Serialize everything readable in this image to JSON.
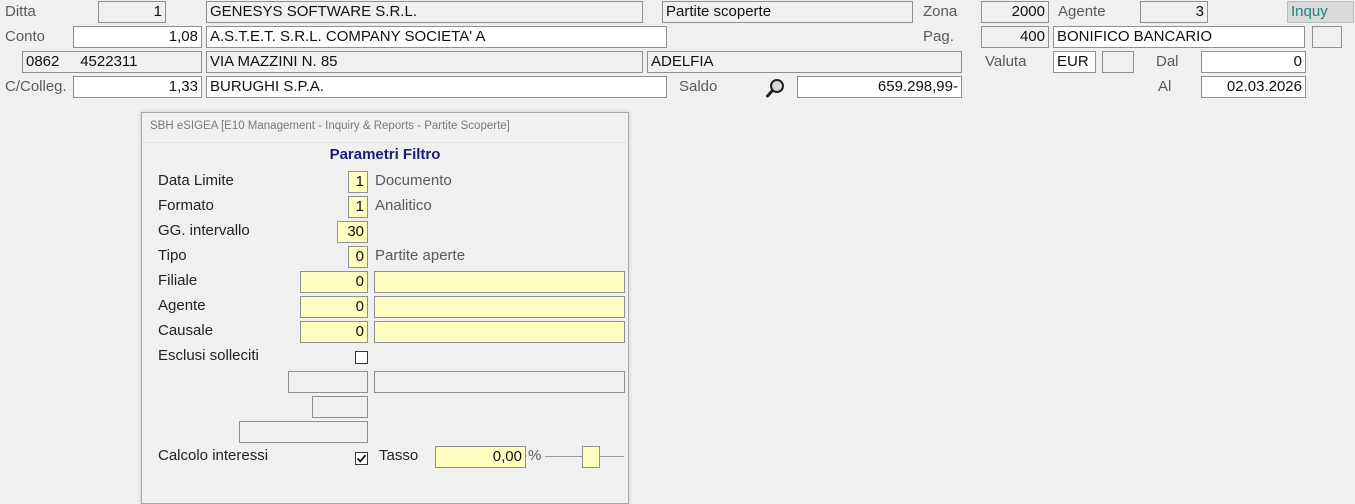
{
  "header": {
    "ditta_label": "Ditta",
    "ditta_code": "1",
    "ditta_name": "GENESYS SOFTWARE S.R.L.",
    "context_title": "Partite scoperte",
    "zona_label": "Zona",
    "zona_value": "2000",
    "agente_label": "Agente",
    "agente_value": "3",
    "mode": "Inquy",
    "conto_label": "Conto",
    "conto_value": "1,08",
    "conto_name": "A.S.T.E.T. S.R.L. COMPANY SOCIETA' A",
    "pag_label": "Pag.",
    "pag_code": "400",
    "pag_desc": "BONIFICO BANCARIO",
    "phone": "0862     4522311",
    "address": "VIA MAZZINI N. 85",
    "city": "ADELFIA",
    "valuta_label": "Valuta",
    "valuta_value": "EUR",
    "dal_label": "Dal",
    "dal_value": "0",
    "colleg_label": "C/Colleg.",
    "colleg_value": "1,33",
    "colleg_name": "BURUGHI S.P.A.",
    "saldo_label": "Saldo",
    "saldo_value": "659.298,99-",
    "al_label": "Al",
    "al_value": "02.03.2026",
    "icons": {
      "saldo_lookup": "magnifier-icon"
    }
  },
  "dialog": {
    "title": "SBH eSIGEA [E10 Management - Inquiry & Reports - Partite Scoperte]",
    "heading": "Parametri Filtro",
    "data_limite": {
      "label": "Data Limite",
      "value": "1",
      "desc": "Documento"
    },
    "formato": {
      "label": "Formato",
      "value": "1",
      "desc": "Analitico"
    },
    "gg_intervallo": {
      "label": "GG. intervallo",
      "value": "30"
    },
    "tipo": {
      "label": "Tipo",
      "value": "0",
      "desc": "Partite aperte"
    },
    "filiale": {
      "label": "Filiale",
      "value": "0",
      "desc": ""
    },
    "agente": {
      "label": "Agente",
      "value": "0",
      "desc": ""
    },
    "causale": {
      "label": "Causale",
      "value": "0",
      "desc": ""
    },
    "esclusi_solleciti": {
      "label": "Esclusi solleciti",
      "checked": false
    },
    "calcolo_interessi": {
      "label": "Calcolo interessi",
      "checked": true
    },
    "tasso": {
      "label": "Tasso",
      "value": "0,00",
      "unit": "%"
    }
  },
  "colors": {
    "field_yellow": "#ffffc0",
    "heading_blue": "#1c1c78",
    "mode_teal": "#1f7f7f"
  }
}
